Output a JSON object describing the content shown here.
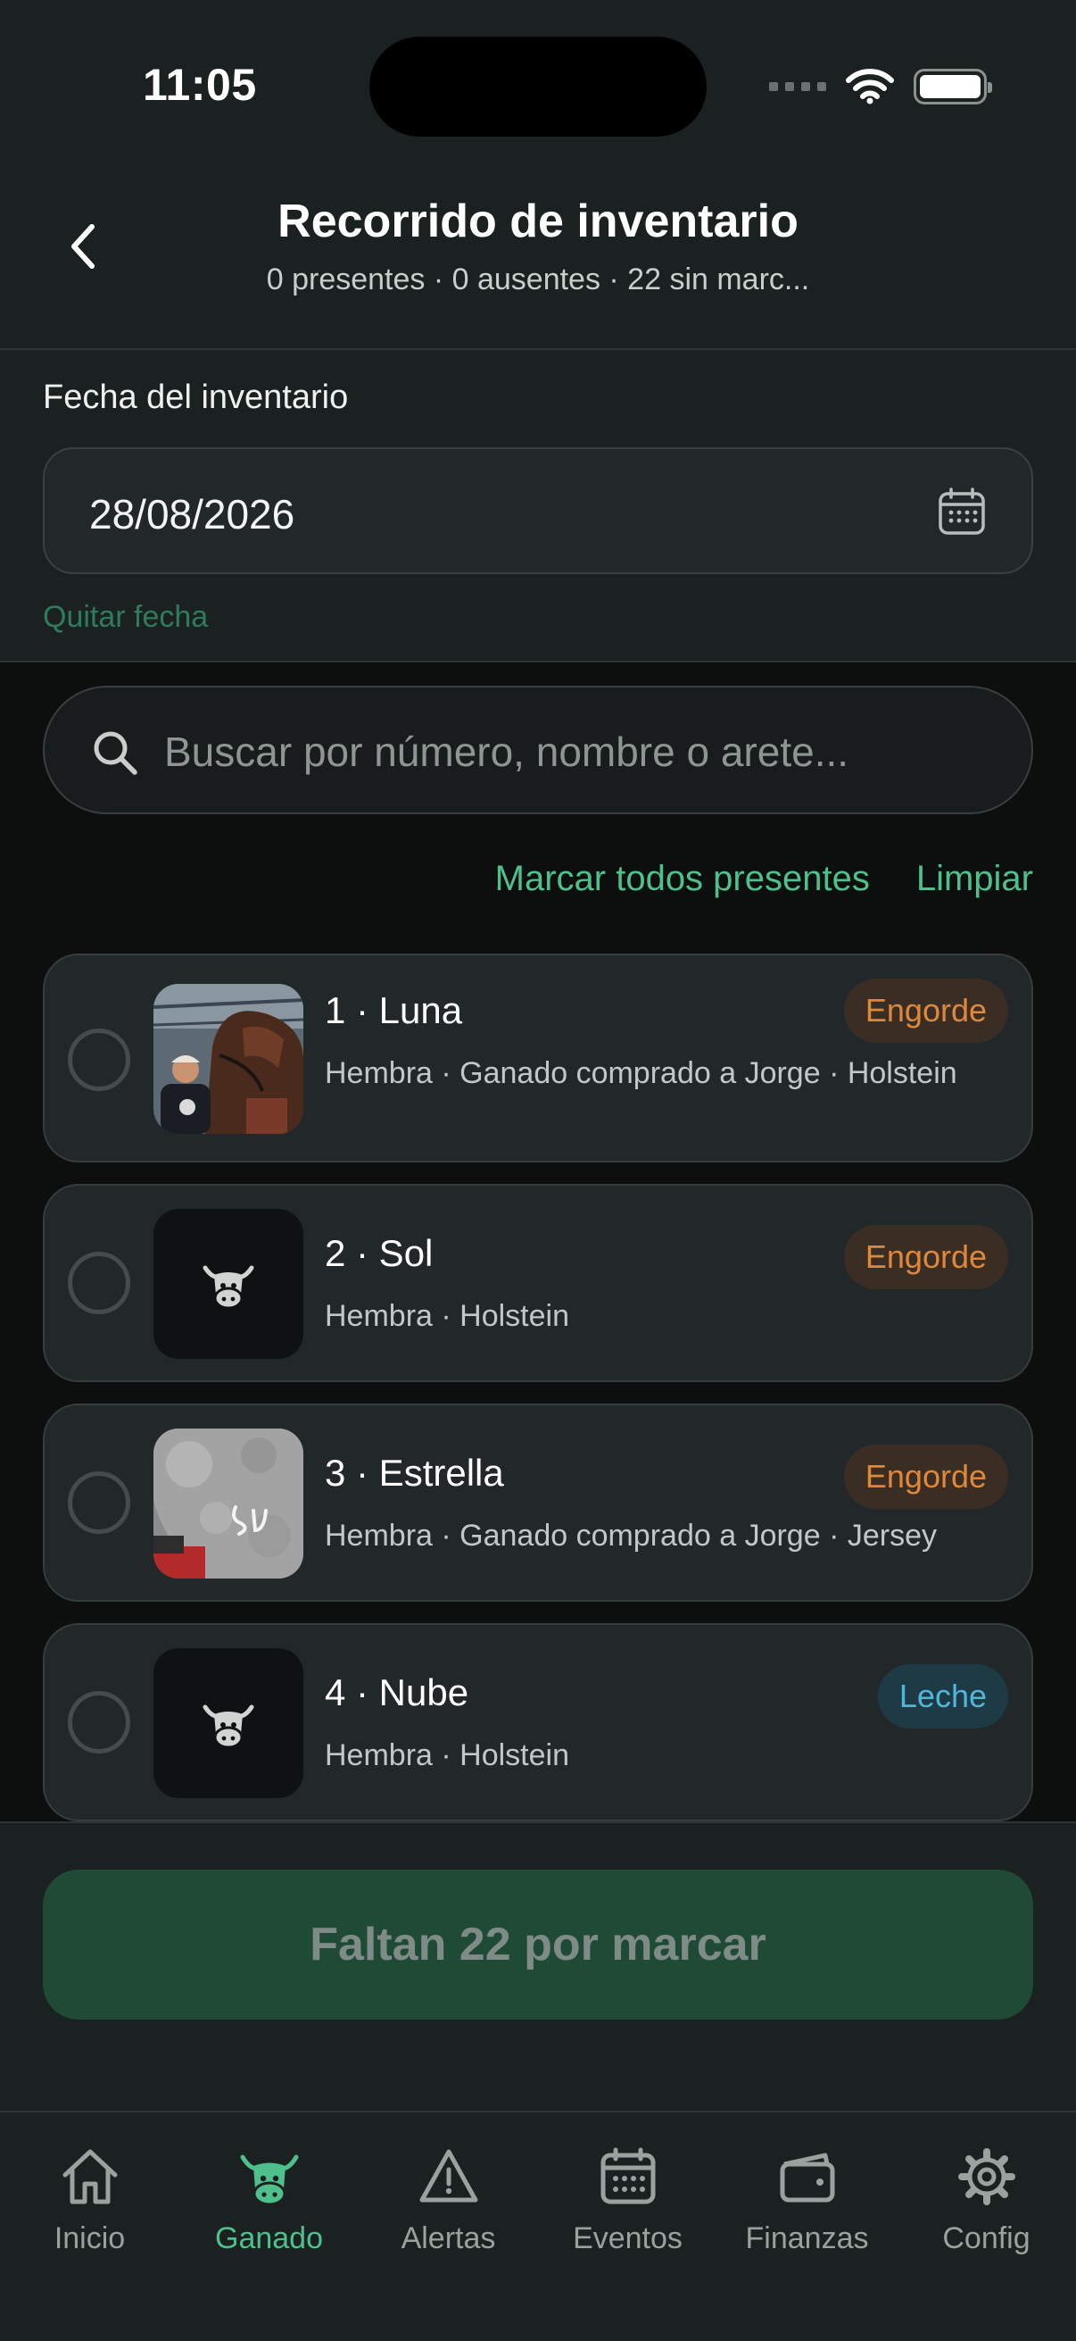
{
  "status_bar": {
    "time": "11:05"
  },
  "header": {
    "title": "Recorrido de inventario",
    "subtitle": "0 presentes · 0 ausentes · 22 sin marc..."
  },
  "date_section": {
    "label": "Fecha del inventario",
    "value": "28/08/2026",
    "clear_label": "Quitar fecha"
  },
  "search": {
    "placeholder": "Buscar por número, nombre o arete..."
  },
  "actions": {
    "mark_all": "Marcar todos presentes",
    "clear": "Limpiar"
  },
  "animals": [
    {
      "title": "1 · Luna",
      "subtitle": "Hembra · Ganado comprado a Jorge · Holstein",
      "badge": "Engorde",
      "badge_type": "engorde",
      "thumb": "photo"
    },
    {
      "title": "2 · Sol",
      "subtitle": "Hembra · Holstein",
      "badge": "Engorde",
      "badge_type": "engorde",
      "thumb": "cow-icon"
    },
    {
      "title": "3 · Estrella",
      "subtitle": "Hembra · Ganado comprado a Jorge · Jersey",
      "badge": "Engorde",
      "badge_type": "engorde",
      "thumb": "photo"
    },
    {
      "title": "4 · Nube",
      "subtitle": "Hembra · Holstein",
      "badge": "Leche",
      "badge_type": "leche",
      "thumb": "cow-icon"
    }
  ],
  "cta": {
    "label": "Faltan 22 por marcar"
  },
  "tabs": [
    {
      "label": "Inicio",
      "icon": "home-icon",
      "active": false
    },
    {
      "label": "Ganado",
      "icon": "cow-icon",
      "active": true
    },
    {
      "label": "Alertas",
      "icon": "alert-icon",
      "active": false
    },
    {
      "label": "Eventos",
      "icon": "calendar-icon",
      "active": false
    },
    {
      "label": "Finanzas",
      "icon": "wallet-icon",
      "active": false
    },
    {
      "label": "Config",
      "icon": "gear-icon",
      "active": false
    }
  ],
  "colors": {
    "accent": "#4fbf8b",
    "background": "#0d0f0f",
    "surface": "#222829",
    "badge_engorde": "#e0873a",
    "badge_leche": "#4fb6dc",
    "cta_background": "#1f4a36"
  }
}
